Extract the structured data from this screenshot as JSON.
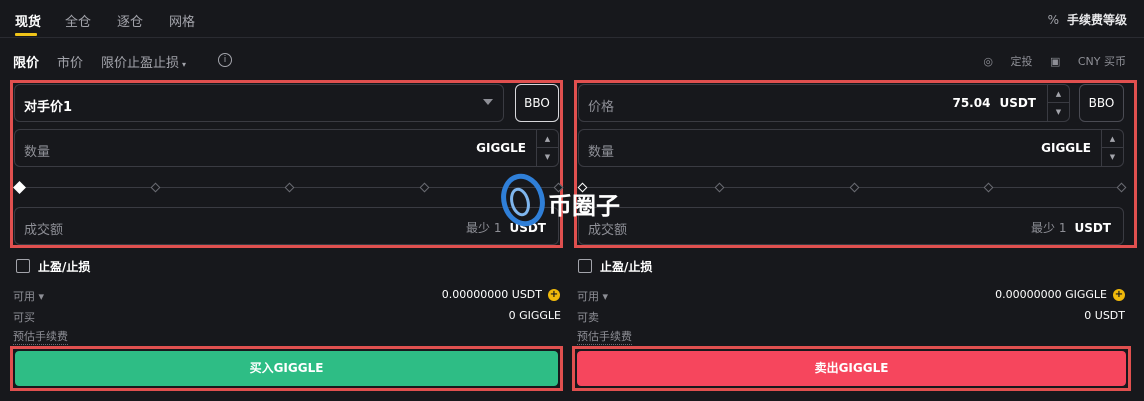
{
  "top_tabs": [
    "现货",
    "全仓",
    "逐仓",
    "网格"
  ],
  "fee_icon": "%",
  "fee_level": "手续费等级",
  "order_types": [
    "限价",
    "市价",
    "限价止盈止损"
  ],
  "order_type_caret": "▾",
  "info_symbol": "i",
  "right_tools": {
    "dca": "定投",
    "cny_buy": "CNY 买币"
  },
  "buy": {
    "price_mode": "对手价1",
    "bbo": "BBO",
    "qty_label": "数量",
    "qty_unit": "GIGGLE",
    "amount_label": "成交额",
    "min_text": "最少 1",
    "amount_unit": "USDT",
    "tpsl": "止盈/止损",
    "available_label": "可用 ▾",
    "available_value": "0.00000000 USDT",
    "max_label": "可买",
    "max_value": "0 GIGGLE",
    "fee_label": "预估手续费",
    "button": "买入GIGGLE"
  },
  "sell": {
    "price_label": "价格",
    "price_value": "75.04",
    "price_unit": "USDT",
    "bbo": "BBO",
    "qty_label": "数量",
    "qty_unit": "GIGGLE",
    "amount_label": "成交额",
    "min_text": "最少 1",
    "amount_unit": "USDT",
    "tpsl": "止盈/止损",
    "available_label": "可用 ▾",
    "available_value": "0.00000000 GIGGLE",
    "max_label": "可卖",
    "max_value": "0 USDT",
    "fee_label": "预估手续费",
    "button": "卖出GIGGLE"
  },
  "plus_symbol": "+",
  "stepper": {
    "up": "▲",
    "down": "▼"
  },
  "watermark": "币圈子",
  "colors": {
    "buy": "#2ebd85",
    "sell": "#f6465d",
    "accent": "#f0c419",
    "highlight": "#e0504f"
  }
}
